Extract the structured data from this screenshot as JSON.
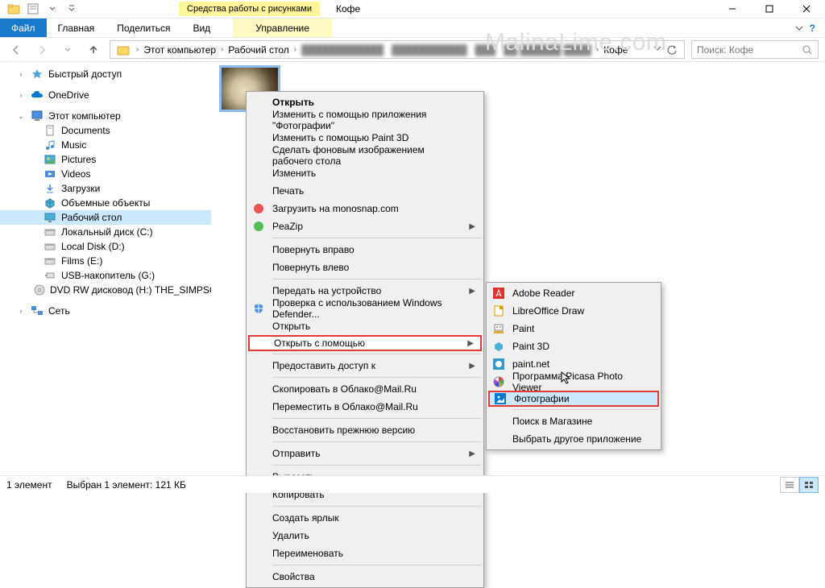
{
  "window": {
    "contextual_tab_title": "Средства работы с рисунками",
    "title": "Кофе",
    "watermark": "MalinaLime.com"
  },
  "ribbon": {
    "file": "Файл",
    "tabs": [
      "Главная",
      "Поделиться",
      "Вид"
    ],
    "contextual": "Управление"
  },
  "address": {
    "items": [
      "Этот компьютер",
      "Рабочий стол",
      "…",
      "Кофе"
    ]
  },
  "search": {
    "placeholder": "Поиск: Кофе"
  },
  "sidebar": {
    "quick_access": "Быстрый доступ",
    "onedrive": "OneDrive",
    "this_pc": "Этот компьютер",
    "children": [
      {
        "label": "Documents",
        "icon": "document-icon"
      },
      {
        "label": "Music",
        "icon": "music-icon"
      },
      {
        "label": "Pictures",
        "icon": "picture-icon"
      },
      {
        "label": "Videos",
        "icon": "video-icon"
      },
      {
        "label": "Загрузки",
        "icon": "download-icon"
      },
      {
        "label": "Объемные объекты",
        "icon": "3d-icon"
      },
      {
        "label": "Рабочий стол",
        "icon": "desktop-icon",
        "selected": true
      },
      {
        "label": "Локальный диск (C:)",
        "icon": "disk-icon"
      },
      {
        "label": "Local Disk (D:)",
        "icon": "disk-icon"
      },
      {
        "label": "Films (E:)",
        "icon": "disk-icon"
      },
      {
        "label": "USB-накопитель (G:)",
        "icon": "usb-icon"
      },
      {
        "label": "DVD RW дисковод (H:) THE_SIMPSONS_MOVIE",
        "icon": "dvd-icon"
      }
    ],
    "network": "Сеть"
  },
  "context_menu": {
    "items": [
      {
        "label": "Открыть",
        "bold": true
      },
      {
        "label": "Изменить с помощью приложения \"Фотографии\""
      },
      {
        "label": "Изменить с помощью Paint 3D"
      },
      {
        "label": "Сделать фоновым изображением рабочего стола"
      },
      {
        "label": "Изменить"
      },
      {
        "label": "Печать"
      },
      {
        "label": "Загрузить на monosnap.com",
        "icon": "monosnap-icon"
      },
      {
        "label": "PeaZip",
        "icon": "peazip-icon",
        "arrow": true
      },
      {
        "sep": true
      },
      {
        "label": "Повернуть вправо"
      },
      {
        "label": "Повернуть влево"
      },
      {
        "sep": true
      },
      {
        "label": "Передать на устройство",
        "arrow": true
      },
      {
        "label": "Проверка с использованием Windows Defender...",
        "icon": "defender-icon"
      },
      {
        "label": "Открыть"
      },
      {
        "label": "Открыть с помощью",
        "arrow": true,
        "highlighted": true
      },
      {
        "sep": true
      },
      {
        "label": "Предоставить доступ к",
        "arrow": true
      },
      {
        "sep": true
      },
      {
        "label": "Скопировать в Облако@Mail.Ru"
      },
      {
        "label": "Переместить в Облако@Mail.Ru"
      },
      {
        "sep": true
      },
      {
        "label": "Восстановить прежнюю версию"
      },
      {
        "sep": true
      },
      {
        "label": "Отправить",
        "arrow": true
      },
      {
        "sep": true
      },
      {
        "label": "Вырезать"
      },
      {
        "label": "Копировать"
      },
      {
        "sep": true
      },
      {
        "label": "Создать ярлык"
      },
      {
        "label": "Удалить"
      },
      {
        "label": "Переименовать"
      },
      {
        "sep": true
      },
      {
        "label": "Свойства"
      }
    ]
  },
  "open_with_menu": {
    "items": [
      {
        "label": "Adobe Reader",
        "icon": "adobe-icon"
      },
      {
        "label": "LibreOffice Draw",
        "icon": "lodraw-icon"
      },
      {
        "label": "Paint",
        "icon": "paint-icon"
      },
      {
        "label": "Paint 3D",
        "icon": "paint3d-icon"
      },
      {
        "label": "paint.net",
        "icon": "paintnet-icon"
      },
      {
        "label": "Программа Picasa Photo Viewer",
        "icon": "picasa-icon"
      },
      {
        "label": "Фотографии",
        "icon": "photos-icon",
        "highlighted": true
      },
      {
        "sep": true
      },
      {
        "label": "Поиск в Магазине"
      },
      {
        "label": "Выбрать другое приложение"
      }
    ]
  },
  "statusbar": {
    "count": "1 элемент",
    "selection": "Выбран 1 элемент: 121 КБ"
  }
}
